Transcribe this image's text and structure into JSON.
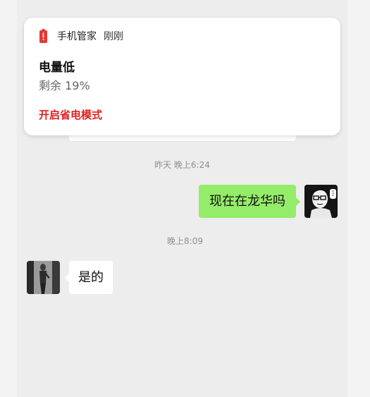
{
  "notification": {
    "app_name": "手机管家",
    "time": "刚刚",
    "title": "电量低",
    "body": "剩余 19%",
    "action_label": "开启省电模式",
    "icon": "battery-low-icon",
    "accent_color": "#e02020"
  },
  "chat": {
    "timestamp_1": "昨天 晚上6:24",
    "timestamp_2": "晚上8:09",
    "messages": [
      {
        "sender": "me",
        "text": "现在在龙华吗",
        "bubble_color": "#95ec69"
      },
      {
        "sender": "other",
        "text": "是的",
        "bubble_color": "#ffffff"
      }
    ]
  }
}
